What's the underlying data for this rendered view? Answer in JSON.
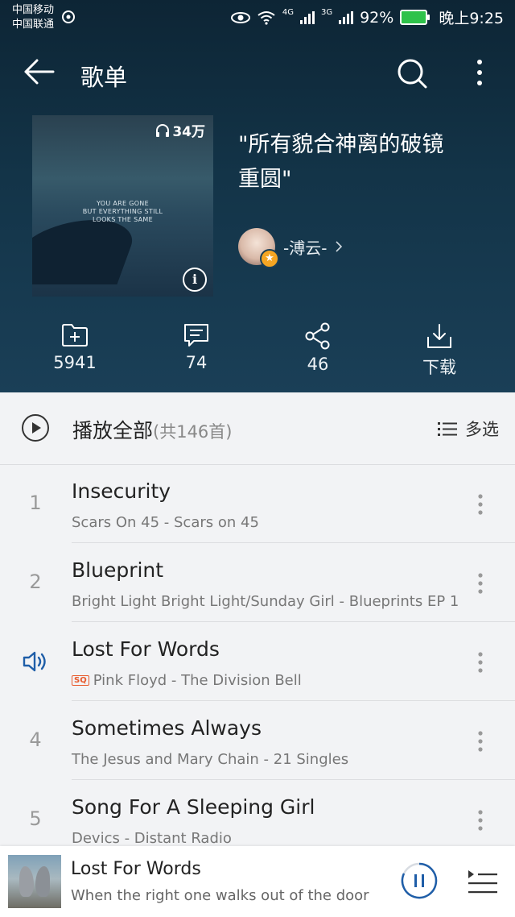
{
  "status": {
    "carrier1": "中国移动",
    "carrier2": "中国联通",
    "signal1": "4G",
    "signal2": "3G",
    "battery": "92%",
    "time": "晚上9:25"
  },
  "topbar": {
    "title": "歌单"
  },
  "playlist": {
    "plays": "34万",
    "cover_text": [
      "YOU ARE GONE",
      "BUT EVERYTHING STILL",
      "LOOKS THE SAME"
    ],
    "title_line1": "\"所有貌合神离的破镜",
    "title_line2": "重圆\"",
    "creator": "-溥云-"
  },
  "actions": [
    {
      "icon": "folder-add-icon",
      "label": "5941"
    },
    {
      "icon": "comment-icon",
      "label": "74"
    },
    {
      "icon": "share-icon",
      "label": "46"
    },
    {
      "icon": "download-icon",
      "label": "下载"
    }
  ],
  "list": {
    "play_all": "播放全部",
    "count": "(共146首)",
    "multi_select": "多选"
  },
  "songs": [
    {
      "num": "1",
      "title": "Insecurity",
      "sub": "Scars On 45 - Scars on 45"
    },
    {
      "num": "2",
      "title": "Blueprint",
      "sub": "Bright Light Bright Light/Sunday Girl - Blueprints EP 1"
    },
    {
      "num": "",
      "title": "Lost For Words",
      "sub": "Pink Floyd - The Division Bell",
      "playing": true,
      "quality": "SQ"
    },
    {
      "num": "4",
      "title": "Sometimes Always",
      "sub": "The Jesus and Mary Chain - 21 Singles"
    },
    {
      "num": "5",
      "title": "Song For A Sleeping Girl",
      "sub": "Devics - Distant Radio"
    }
  ],
  "player": {
    "title": "Lost For Words",
    "lyric": "When the right one walks out of the door"
  },
  "colors": {
    "accent": "#1f5ea8",
    "sq": "#e85a2c"
  }
}
